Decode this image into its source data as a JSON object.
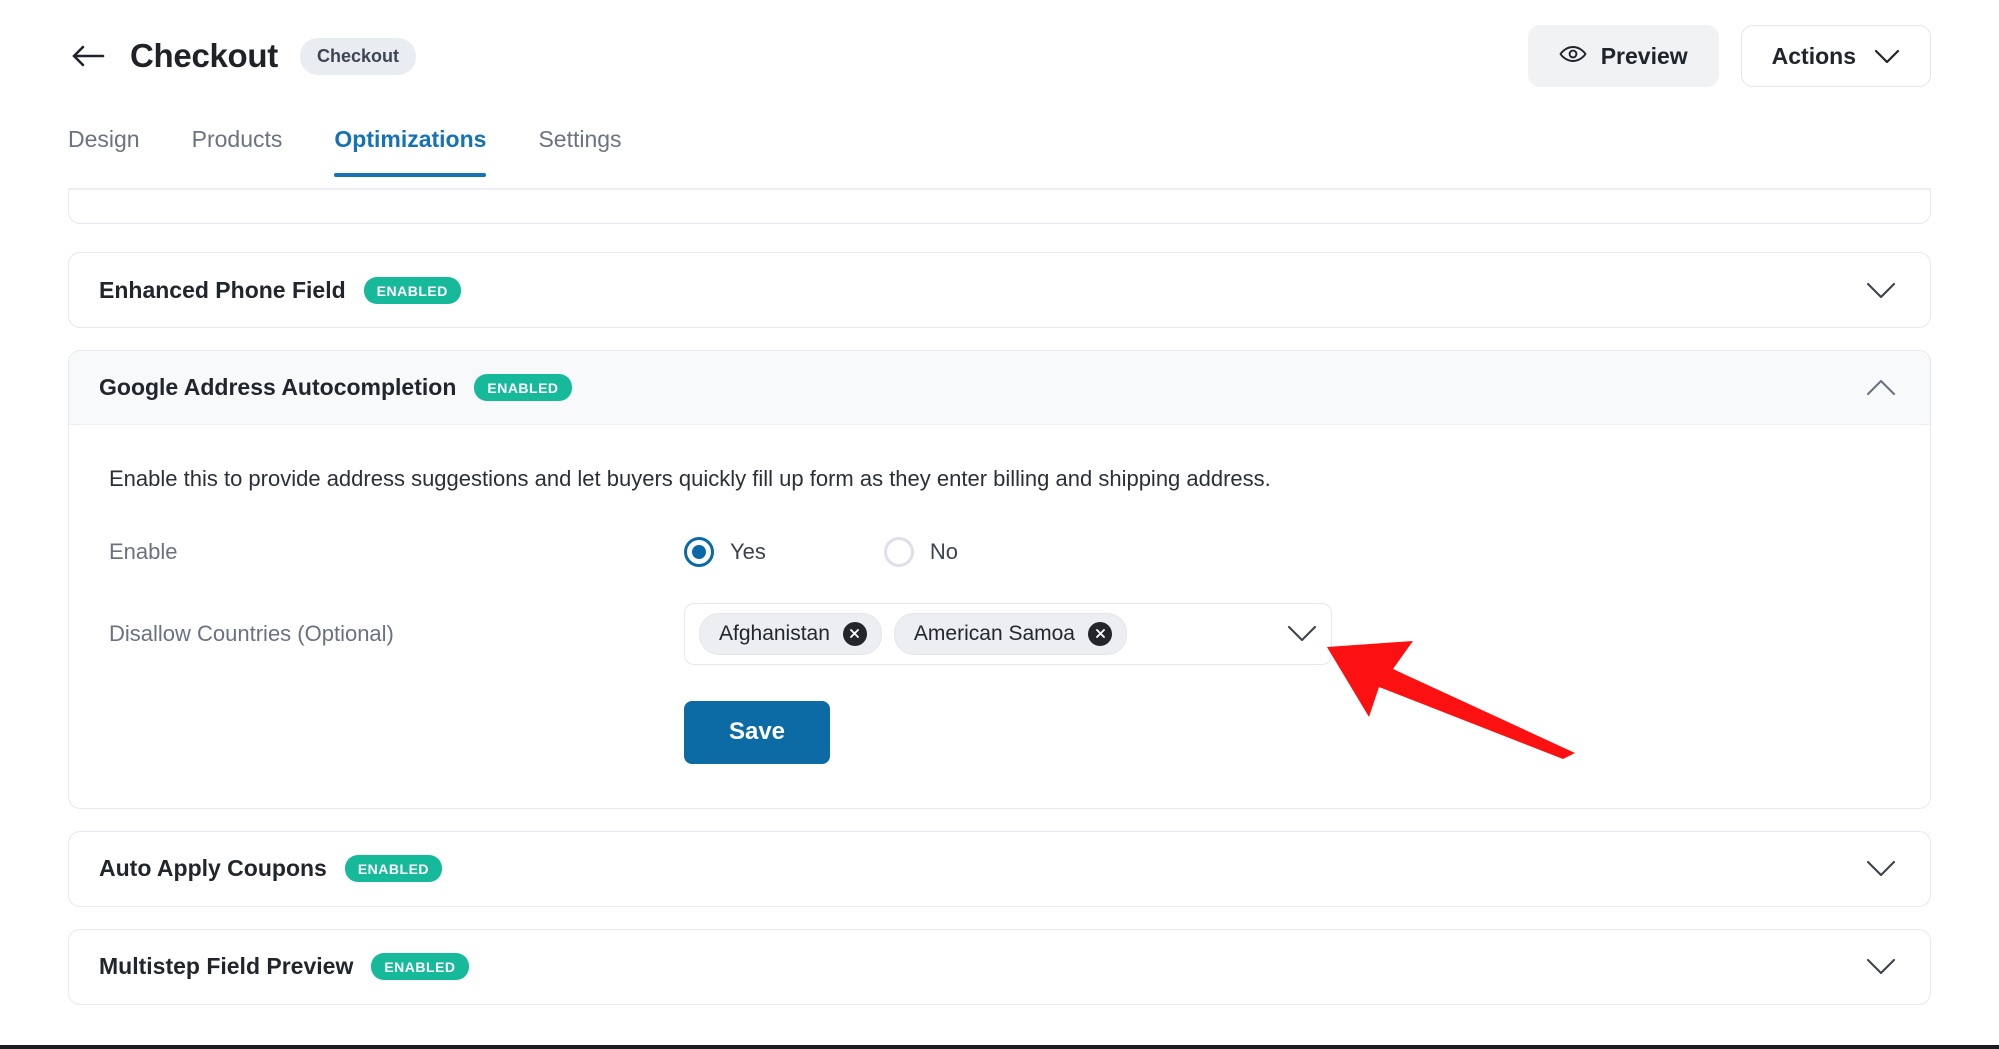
{
  "header": {
    "back_icon": "arrow-left-icon",
    "title": "Checkout",
    "badge": "Checkout",
    "preview_label": "Preview",
    "preview_icon": "eye-icon",
    "actions_label": "Actions",
    "actions_icon": "chevron-down-icon"
  },
  "tabs": [
    {
      "label": "Design",
      "active": false
    },
    {
      "label": "Products",
      "active": false
    },
    {
      "label": "Optimizations",
      "active": true
    },
    {
      "label": "Settings",
      "active": false
    }
  ],
  "accordion": {
    "enabled_badge": "ENABLED",
    "items": [
      {
        "title": "Enhanced Phone Field",
        "badge": "ENABLED",
        "expanded": false,
        "chevron": "chevron-down-icon"
      },
      {
        "title": "Google Address Autocompletion",
        "badge": "ENABLED",
        "expanded": true,
        "chevron": "chevron-up-icon"
      },
      {
        "title": "Auto Apply Coupons",
        "badge": "ENABLED",
        "expanded": false,
        "chevron": "chevron-down-icon"
      },
      {
        "title": "Multistep Field Preview",
        "badge": "ENABLED",
        "expanded": false,
        "chevron": "chevron-down-icon"
      }
    ]
  },
  "panel": {
    "description": "Enable this to provide address suggestions and let buyers quickly fill up form as they enter billing and shipping address.",
    "enable_label": "Enable",
    "radio_yes": "Yes",
    "radio_no": "No",
    "selected_value": "Yes",
    "countries_label": "Disallow Countries (Optional)",
    "countries": [
      {
        "name": "Afghanistan",
        "remove_icon": "close-circle-icon"
      },
      {
        "name": "American Samoa",
        "remove_icon": "close-circle-icon"
      }
    ],
    "dropdown_icon": "chevron-down-icon",
    "save_label": "Save"
  },
  "annotation": {
    "type": "arrow",
    "color": "#fb1111",
    "points_to": "disallow-countries-dropdown-chevron"
  },
  "colors": {
    "accent_blue": "#1572b5",
    "save_blue": "#0c6ba4",
    "badge_green": "#17b99b",
    "text_primary": "#21252c",
    "text_muted": "#6a7280",
    "card_border": "#e7e8f0",
    "panel_head_bg": "#f8f9fb",
    "annotation_red": "#fb1111"
  }
}
